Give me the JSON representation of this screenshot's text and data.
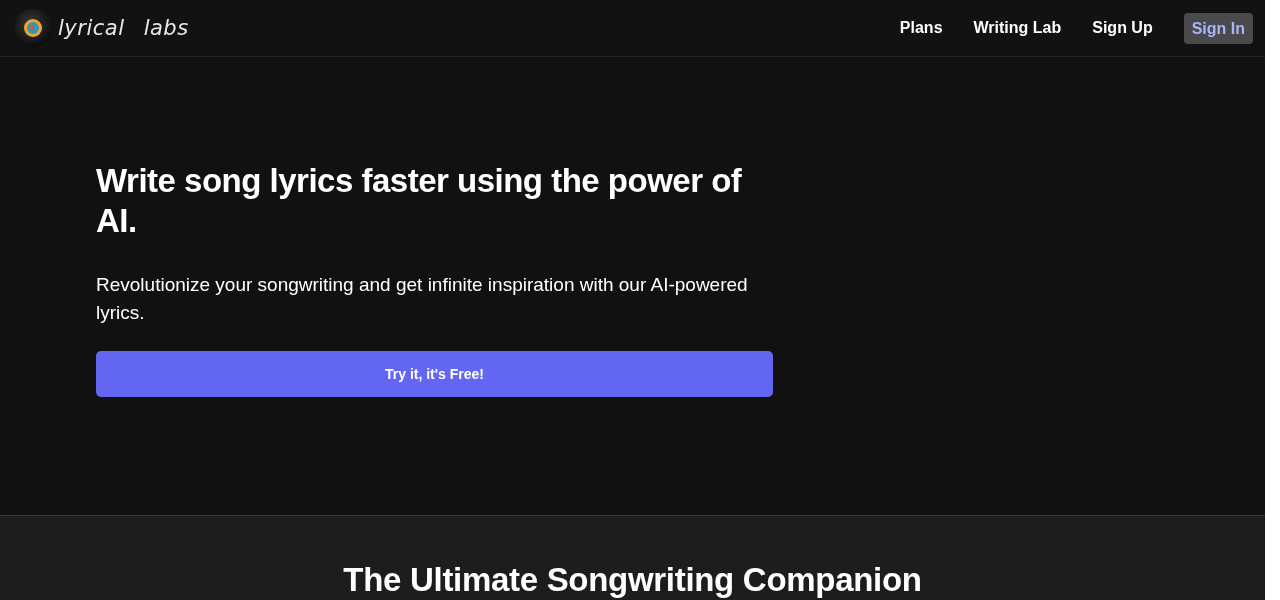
{
  "header": {
    "logo_text": "lyrical labs",
    "nav": [
      {
        "label": "Plans",
        "kind": "link"
      },
      {
        "label": "Writing Lab",
        "kind": "link"
      },
      {
        "label": "Sign Up",
        "kind": "link"
      },
      {
        "label": "Sign In",
        "kind": "button"
      }
    ]
  },
  "hero": {
    "title": "Write song lyrics faster using the power of AI.",
    "subtitle": "Revolutionize your songwriting and get infinite inspiration with our AI-powered lyrics.",
    "cta": "Try it, it's Free!"
  },
  "features": {
    "title": "The Ultimate Songwriting Companion"
  }
}
